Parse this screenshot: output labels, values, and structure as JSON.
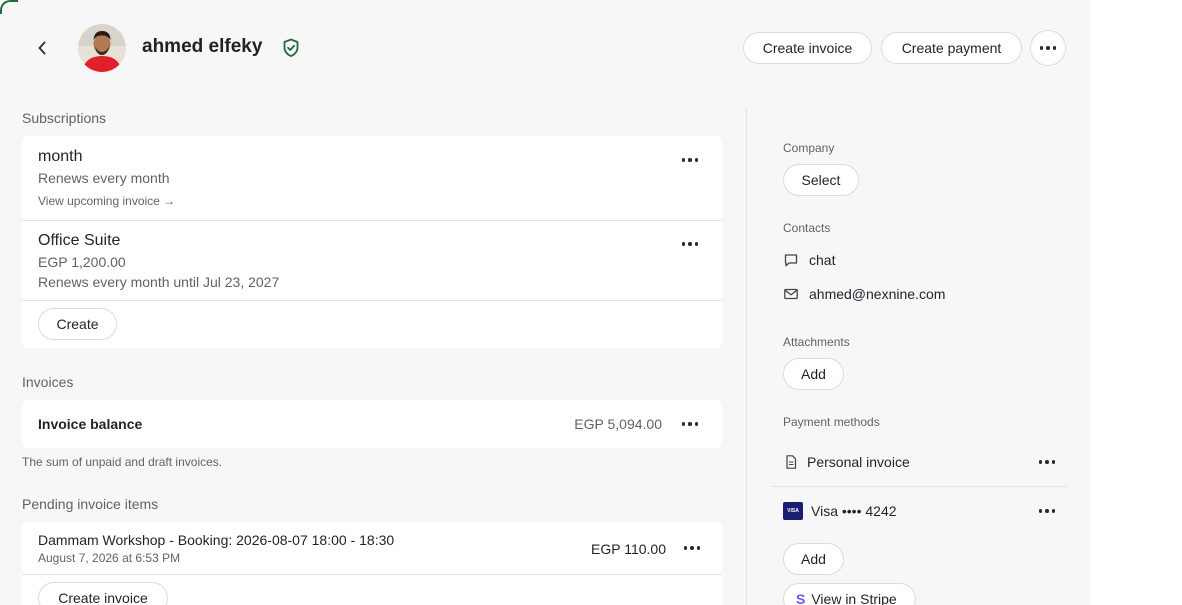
{
  "header": {
    "customer_name": "ahmed elfeky",
    "create_invoice_label": "Create invoice",
    "create_payment_label": "Create payment"
  },
  "subscriptions": {
    "title": "Subscriptions",
    "items": [
      {
        "name": "month",
        "line1": "Renews every month",
        "link": "View upcoming invoice →"
      },
      {
        "name": "Office Suite",
        "line1": "EGP 1,200.00",
        "line2": "Renews every month until Jul 23, 2027"
      }
    ],
    "create_label": "Create"
  },
  "invoices": {
    "title": "Invoices",
    "balance_label": "Invoice balance",
    "balance_value": "EGP 5,094.00",
    "note": "The sum of unpaid and draft invoices."
  },
  "pending": {
    "title": "Pending invoice items",
    "item_title": "Dammam Workshop - Booking: 2026-08-07 18:00 - 18:30",
    "item_date": "August 7, 2026 at 6:53 PM",
    "item_amount": "EGP 110.00",
    "create_invoice_label": "Create invoice"
  },
  "sidebar": {
    "company_label": "Company",
    "company_select": "Select",
    "contacts_label": "Contacts",
    "contact_chat": "chat",
    "contact_email": "ahmed@nexnine.com",
    "attachments_label": "Attachments",
    "attachments_add": "Add",
    "payment_methods_label": "Payment methods",
    "pm_invoice": "Personal invoice",
    "pm_card_brand": "VISA",
    "pm_card": "Visa •••• 4242",
    "pm_add": "Add",
    "view_in_stripe": "View in Stripe",
    "stripe_letter": "S"
  },
  "colors": {
    "panel_bg": "#f7f7f8",
    "verified_green": "#1f6b3a",
    "visa_navy": "#1a1f71",
    "stripe_purple": "#635bff"
  }
}
